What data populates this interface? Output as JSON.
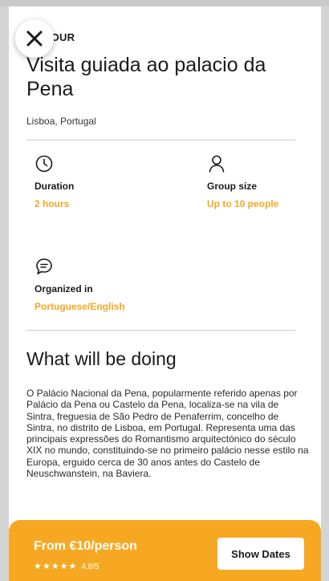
{
  "theme": {
    "accent": "#f5a623",
    "booking_bar": "#f6a822",
    "text": "#1a1a1a"
  },
  "header": {
    "close_icon": "close-icon",
    "eyebrow": "ED TOUR",
    "title": "Visita guiada ao palacio da Pena",
    "location": "Lisboa, Portugal"
  },
  "features": {
    "duration": {
      "icon": "clock-icon",
      "label": "Duration",
      "value": "2 hours"
    },
    "group_size": {
      "icon": "person-icon",
      "label": "Group size",
      "value": "Up to 10 people"
    },
    "language": {
      "icon": "chat-bubble-icon",
      "label": "Organized in",
      "value": "Portuguese/English"
    }
  },
  "about": {
    "heading": "What will be doing",
    "body": "O Palácio Nacional da Pena, popularmente referido apenas por Palácio da Pena ou Castelo da Pena, localiza-se na vila de Sintra, freguesia de São Pedro de Penaferrim, concelho de Sintra, no distrito de Lisboa, em Portugal. Representa uma das principais expressões do Romantismo arquitectónico do século XIX no mundo, constituindo-se no primeiro palácio nesse estilo na Europa, erguido cerca de 30 anos antes do Castelo de Neuschwanstein, na Baviera."
  },
  "booking": {
    "price": "From €10/person",
    "stars": "★★★★★",
    "rating": 4.8,
    "rating_text": "4.8/5",
    "button_label": "Show Dates"
  }
}
